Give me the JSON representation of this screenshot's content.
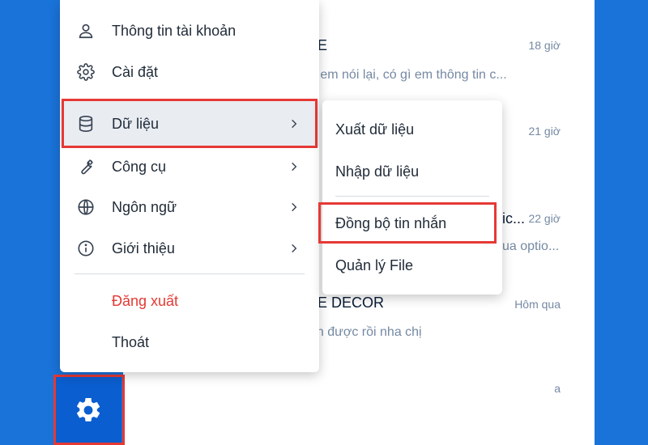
{
  "main_menu": {
    "account_info": "Thông tin tài khoản",
    "settings": "Cài đặt",
    "data": "Dữ liệu",
    "tools": "Công cụ",
    "language": "Ngôn ngữ",
    "about": "Giới thiệu",
    "logout": "Đăng xuất",
    "exit": "Thoát"
  },
  "data_submenu": {
    "export": "Xuất dữ liệu",
    "import": "Nhập dữ liệu",
    "sync": "Đồng bộ tin nhắn",
    "file_manager": "Quản lý File"
  },
  "chat_list": [
    {
      "name": "E",
      "time": "18 giờ",
      "preview": "ể em nói lại, có gì em thông tin c..."
    },
    {
      "name": "",
      "time": "21 giờ",
      "preview": ""
    },
    {
      "name": "ic...",
      "time": "22 giờ",
      "preview": "ua optio..."
    },
    {
      "name": "LE DECOR",
      "time": "Hôm qua",
      "preview": "ận được rồi nha chị"
    },
    {
      "name": "",
      "time": "a",
      "preview": ""
    }
  ],
  "colors": {
    "brand_blue": "#1a73d9",
    "settings_button": "#0b5ecf",
    "highlight_red": "#e53935",
    "logout_red": "#e53935"
  }
}
